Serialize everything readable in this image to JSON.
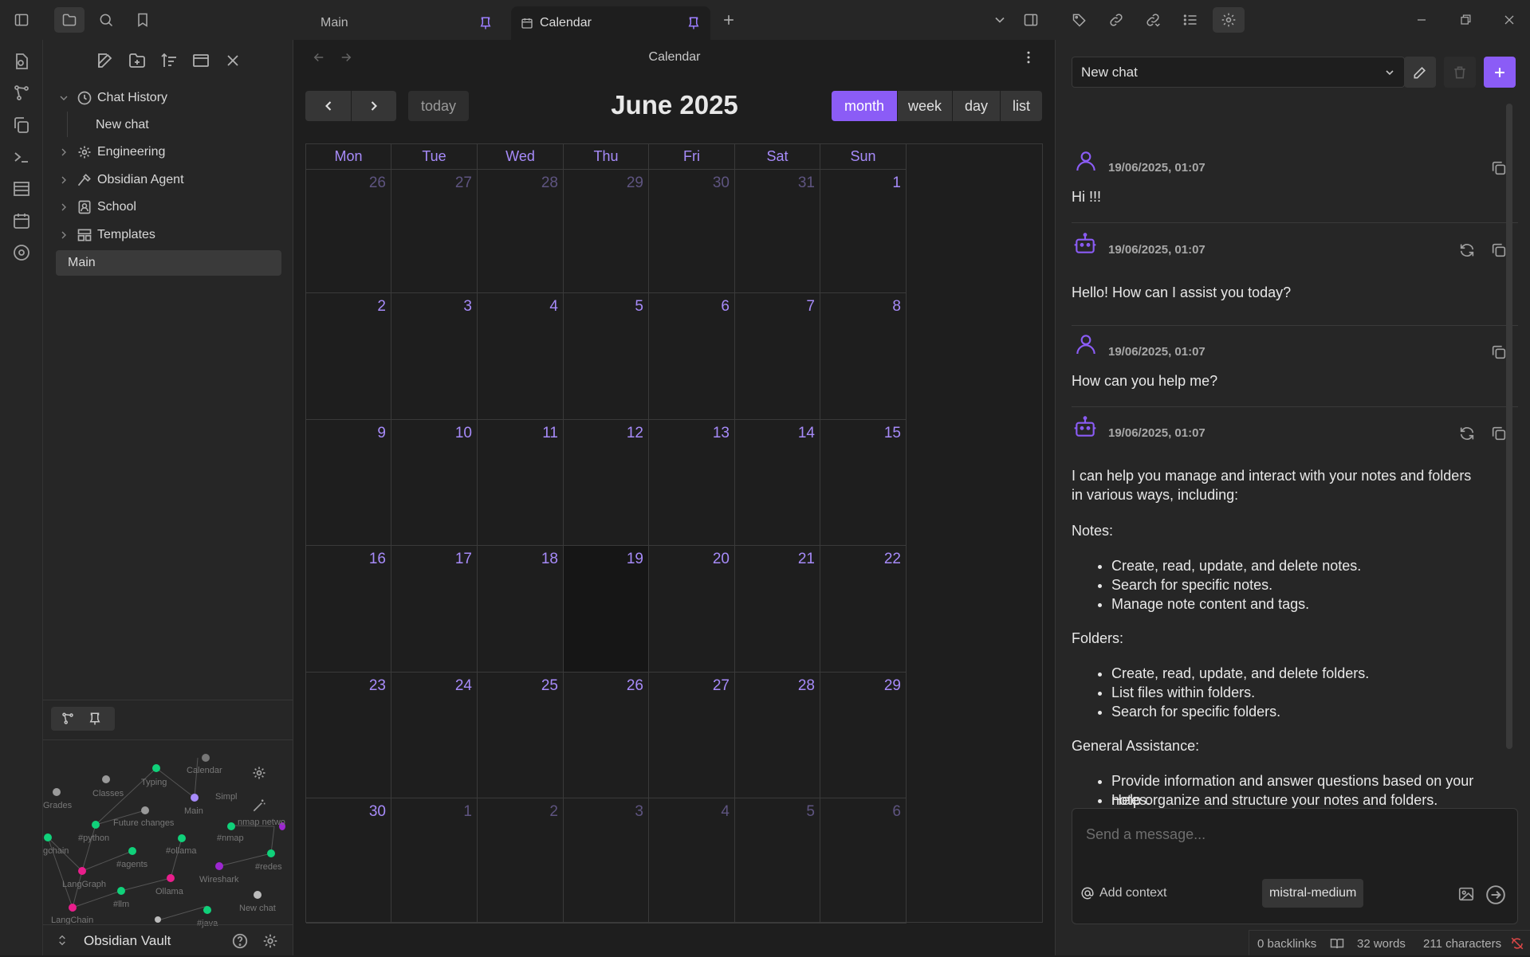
{
  "tabs": [
    {
      "label": "Main"
    },
    {
      "label": "Calendar"
    }
  ],
  "sidebar": {
    "tree": [
      {
        "label": "Chat History",
        "icon": "clock-icon",
        "expanded": true
      },
      {
        "label": "New chat"
      },
      {
        "label": "Engineering",
        "icon": "gear-icon"
      },
      {
        "label": "Obsidian Agent",
        "icon": "hammer-icon"
      },
      {
        "label": "School",
        "icon": "contact-icon"
      },
      {
        "label": "Templates",
        "icon": "layout-icon"
      },
      {
        "label": "Main"
      }
    ],
    "vault_name": "Obsidian Vault"
  },
  "graph": {
    "labels": [
      "Calendar",
      "Typing",
      "Classes",
      "Simpl",
      "Grades",
      "Main",
      "Future changes",
      "nmap netwo",
      "#nmap",
      "#python",
      "gchain",
      "#ollama",
      "#agents",
      "#redes",
      "LangGraph",
      "Wireshark",
      "Ollama",
      "#llm",
      "New chat",
      "LangChain",
      "#java"
    ],
    "colors": {
      "note": "#9a9a9a",
      "tag": "#10d17a",
      "agent": "#e91e8c",
      "purple": "#9c27d0",
      "current": "#a78bfa"
    }
  },
  "calendar": {
    "header_title": "Calendar",
    "title": "June 2025",
    "today_label": "today",
    "views": [
      "month",
      "week",
      "day",
      "list"
    ],
    "active_view": "month",
    "weekdays": [
      "Mon",
      "Tue",
      "Wed",
      "Thu",
      "Fri",
      "Sat",
      "Sun"
    ],
    "weeks": [
      [
        "26",
        "27",
        "28",
        "29",
        "30",
        "31",
        "1"
      ],
      [
        "2",
        "3",
        "4",
        "5",
        "6",
        "7",
        "8"
      ],
      [
        "9",
        "10",
        "11",
        "12",
        "13",
        "14",
        "15"
      ],
      [
        "16",
        "17",
        "18",
        "19",
        "20",
        "21",
        "22"
      ],
      [
        "23",
        "24",
        "25",
        "26",
        "27",
        "28",
        "29"
      ],
      [
        "30",
        "1",
        "2",
        "3",
        "4",
        "5",
        "6"
      ]
    ],
    "today": "19",
    "accent": "#8b5cf6"
  },
  "chat": {
    "selector": "New chat",
    "messages": [
      {
        "role": "user",
        "time": "19/06/2025, 01:07",
        "text": "Hi !!!"
      },
      {
        "role": "assistant",
        "time": "19/06/2025, 01:07",
        "text": "Hello! How can I assist you today?"
      },
      {
        "role": "user",
        "time": "19/06/2025, 01:07",
        "text": "How can you help me?"
      },
      {
        "role": "assistant",
        "time": "19/06/2025, 01:07",
        "intro1": "I can help you manage and interact with your notes and folders",
        "intro2": "in various ways, including:",
        "notes_heading": "Notes:",
        "notes": [
          "Create, read, update, and delete notes.",
          "Search for specific notes.",
          "Manage note content and tags."
        ],
        "folders_heading": "Folders:",
        "folders": [
          "Create, read, update, and delete folders.",
          "List files within folders.",
          "Search for specific folders."
        ],
        "general_heading": "General Assistance:",
        "general_1a": "Provide information and answer questions based on your",
        "general_1b": "notes.",
        "general_2": "Help organize and structure your notes and folders."
      }
    ],
    "input_placeholder": "Send a message...",
    "add_context": "Add context",
    "model": "mistral-medium"
  },
  "status": {
    "backlinks": "0 backlinks",
    "words": "32 words",
    "characters": "211 characters"
  }
}
